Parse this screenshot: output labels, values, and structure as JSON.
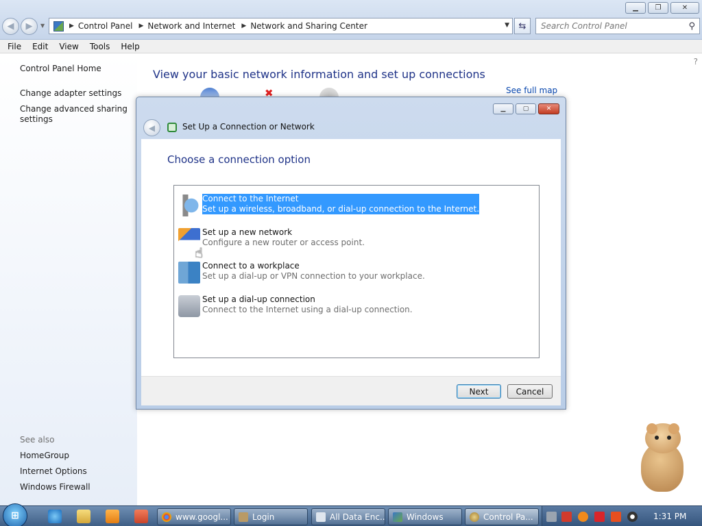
{
  "window": {
    "caption_buttons": [
      "minimize",
      "restore",
      "close"
    ]
  },
  "nav": {
    "breadcrumb": [
      "Control Panel",
      "Network and Internet",
      "Network and Sharing Center"
    ],
    "search_placeholder": "Search Control Panel"
  },
  "menu": [
    "File",
    "Edit",
    "View",
    "Tools",
    "Help"
  ],
  "left": {
    "home": "Control Panel Home",
    "links": [
      "Change adapter settings",
      "Change advanced sharing settings"
    ],
    "see_also_label": "See also",
    "see_also": [
      "HomeGroup",
      "Internet Options",
      "Windows Firewall"
    ]
  },
  "main": {
    "title": "View your basic network information and set up connections",
    "see_full_map": "See full map"
  },
  "dialog": {
    "title": "Set Up a Connection or Network",
    "heading": "Choose a connection option",
    "options": [
      {
        "title": "Connect to the Internet",
        "desc": "Set up a wireless, broadband, or dial-up connection to the Internet.",
        "icon": "internet-globe-icon",
        "selected": true
      },
      {
        "title": "Set up a new network",
        "desc": "Configure a new router or access point.",
        "icon": "new-network-icon",
        "selected": false
      },
      {
        "title": "Connect to a workplace",
        "desc": "Set up a dial-up or VPN connection to your workplace.",
        "icon": "workplace-icon",
        "selected": false
      },
      {
        "title": "Set up a dial-up connection",
        "desc": "Connect to the Internet using a dial-up connection.",
        "icon": "dialup-phone-icon",
        "selected": false
      }
    ],
    "next": "Next",
    "cancel": "Cancel"
  },
  "taskbar": {
    "buttons": [
      "www.googl...",
      "Login",
      "All Data Enc...",
      "Windows",
      "Control Pa..."
    ],
    "active": "Control Pa...",
    "clock": "1:31 PM"
  },
  "colors": {
    "selection": "#3399ff",
    "heading": "#1e3287",
    "link": "#0645ad"
  }
}
